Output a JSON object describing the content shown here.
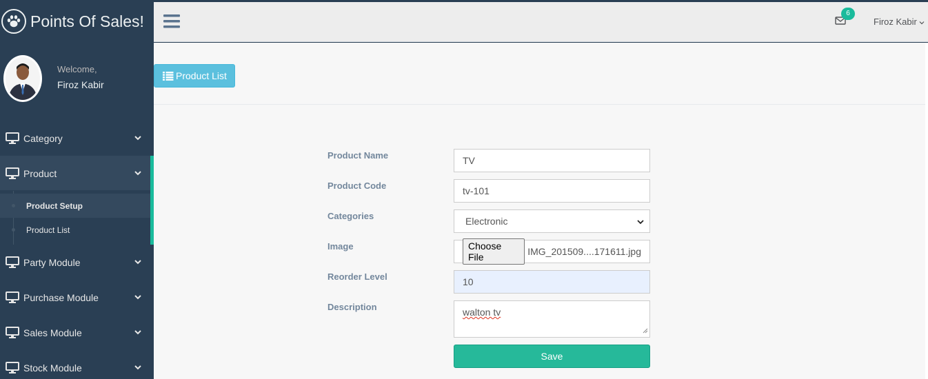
{
  "brand": {
    "title": "Points Of Sales!",
    "logo_icon": "paw-icon"
  },
  "profile": {
    "welcome": "Welcome,",
    "name": "Firoz Kabir"
  },
  "sidebar": {
    "items": [
      {
        "label": "Category",
        "icon": "desktop-icon"
      },
      {
        "label": "Product",
        "icon": "desktop-icon",
        "active": true,
        "children": [
          {
            "label": "Product Setup",
            "current": true
          },
          {
            "label": "Product List"
          }
        ]
      },
      {
        "label": "Party Module",
        "icon": "desktop-icon"
      },
      {
        "label": "Purchase Module",
        "icon": "desktop-icon"
      },
      {
        "label": "Sales Module",
        "icon": "desktop-icon"
      },
      {
        "label": "Stock Module",
        "icon": "desktop-icon"
      }
    ]
  },
  "topnav": {
    "mail_count": "6",
    "user": "Firoz Kabir"
  },
  "toolbar": {
    "product_list_label": "Product List"
  },
  "form": {
    "product_name": {
      "label": "Product Name",
      "value": "TV"
    },
    "product_code": {
      "label": "Product Code",
      "value": "tv-101"
    },
    "categories": {
      "label": "Categories",
      "value": "Electronic"
    },
    "image": {
      "label": "Image",
      "button": "Choose File",
      "file": "IMG_201509....171611.jpg"
    },
    "reorder_level": {
      "label": "Reorder Level",
      "value": "10"
    },
    "description": {
      "label": "Description",
      "value": "walton tv"
    },
    "save_label": "Save"
  },
  "colors": {
    "sidebar": "#2A3F54",
    "accent": "#1ABB9C",
    "info": "#5BC0DE",
    "success": "#26B99A"
  }
}
